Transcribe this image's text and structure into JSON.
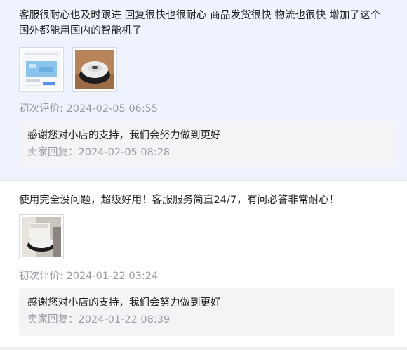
{
  "reviews": [
    {
      "text": "客服很耐心也及时跟进 回复很快也很耐心 商品发货很快 物流也很快 增加了这个 国外都能用国内的智能机了",
      "images": [
        "app-screenshot-photo",
        "robot-vacuum-photo"
      ],
      "date_label": "初次评价: 2024-02-05 06:55",
      "reply": {
        "text": "感谢您对小店的支持，我们会努力做到更好",
        "meta": "卖家回复：2024-02-05 08:28"
      }
    },
    {
      "text": "使用完全没问题，超级好用！客服服务简直24/7，有问必答非常耐心！",
      "images": [
        "robot-vacuum-dock-photo"
      ],
      "date_label": "初次评价: 2024-01-22 03:24",
      "reply": {
        "text": "感谢您对小店的支持，我们会努力做到更好",
        "meta": "卖家回复：2024-01-22 08:39"
      }
    }
  ]
}
